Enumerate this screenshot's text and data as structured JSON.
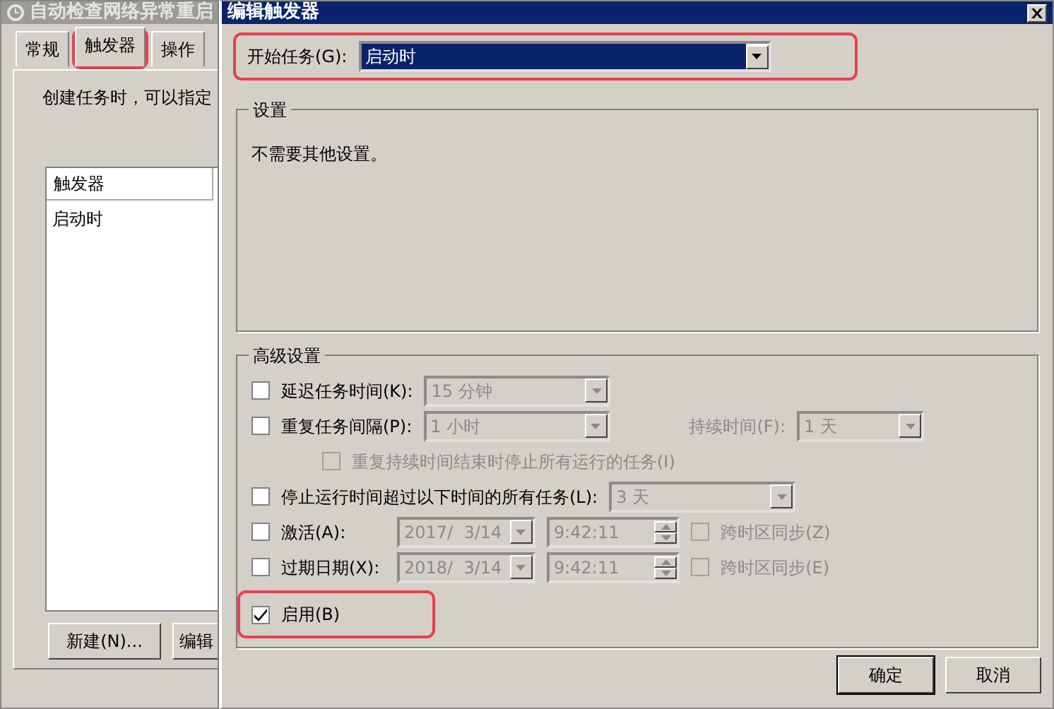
{
  "background_window": {
    "title": "自动检查网络异常重启",
    "tabs": [
      {
        "label": "常规",
        "selected": false,
        "highlighted": false
      },
      {
        "label": "触发器",
        "selected": true,
        "highlighted": true
      },
      {
        "label": "操作",
        "selected": false,
        "highlighted": false
      }
    ],
    "description": "创建任务时，可以指定",
    "table": {
      "columns": [
        "触发器"
      ],
      "rows": [
        {
          "cells": [
            "启动时"
          ]
        }
      ]
    },
    "buttons": [
      "新建(N)...",
      "编辑"
    ]
  },
  "dialog": {
    "title": "编辑触发器",
    "start_task": {
      "label": "开始任务(G):",
      "value": "启动时",
      "highlighted": true
    },
    "settings": {
      "title": "设置",
      "text": "不需要其他设置。"
    },
    "advanced": {
      "title": "高级设置",
      "rows": [
        {
          "indented": false,
          "controls": [
            {
              "kind": "checkbox",
              "label": "延迟任务时间(K):",
              "checked": false,
              "disabled": false
            },
            {
              "kind": "select",
              "value": "15 分钟",
              "disabled": true
            }
          ]
        },
        {
          "indented": false,
          "controls": [
            {
              "kind": "checkbox",
              "label": "重复任务间隔(P):",
              "checked": false,
              "disabled": false
            },
            {
              "kind": "select",
              "value": "1 小时",
              "disabled": true
            }
          ],
          "right": [
            {
              "kind": "label",
              "text": "持续时间(F):",
              "disabled": true
            },
            {
              "kind": "select",
              "value": "1 天",
              "disabled": true
            }
          ]
        },
        {
          "indented": true,
          "controls": [
            {
              "kind": "checkbox",
              "label": "重复持续时间结束时停止所有运行的任务(I)",
              "checked": false,
              "disabled": true
            }
          ]
        },
        {
          "indented": false,
          "controls": [
            {
              "kind": "checkbox",
              "label": "停止运行时间超过以下时间的所有任务(L):",
              "checked": false,
              "disabled": false
            },
            {
              "kind": "select",
              "value": "3 天",
              "disabled": true
            }
          ]
        },
        {
          "indented": false,
          "controls": [
            {
              "kind": "checkbox",
              "label": "激活(A):",
              "checked": false,
              "disabled": false
            },
            {
              "kind": "date",
              "value": "2017/  3/14",
              "disabled": true
            },
            {
              "kind": "time",
              "value": "9:42:11",
              "disabled": true
            }
          ],
          "right": [
            {
              "kind": "checkbox",
              "label": "跨时区同步(Z)",
              "checked": false,
              "disabled": true
            }
          ]
        },
        {
          "indented": false,
          "controls": [
            {
              "kind": "checkbox",
              "label": "过期日期(X):",
              "checked": false,
              "disabled": false
            },
            {
              "kind": "date",
              "value": "2018/  3/14",
              "disabled": true
            },
            {
              "kind": "time",
              "value": "9:42:11",
              "disabled": true
            }
          ],
          "right": [
            {
              "kind": "checkbox",
              "label": "跨时区同步(E)",
              "checked": false,
              "disabled": true
            }
          ]
        }
      ],
      "enabled": {
        "label": "启用(B)",
        "checked": true,
        "highlighted": true
      }
    },
    "buttons": [
      {
        "label": "确定",
        "default": true
      },
      {
        "label": "取消",
        "default": false
      }
    ]
  }
}
